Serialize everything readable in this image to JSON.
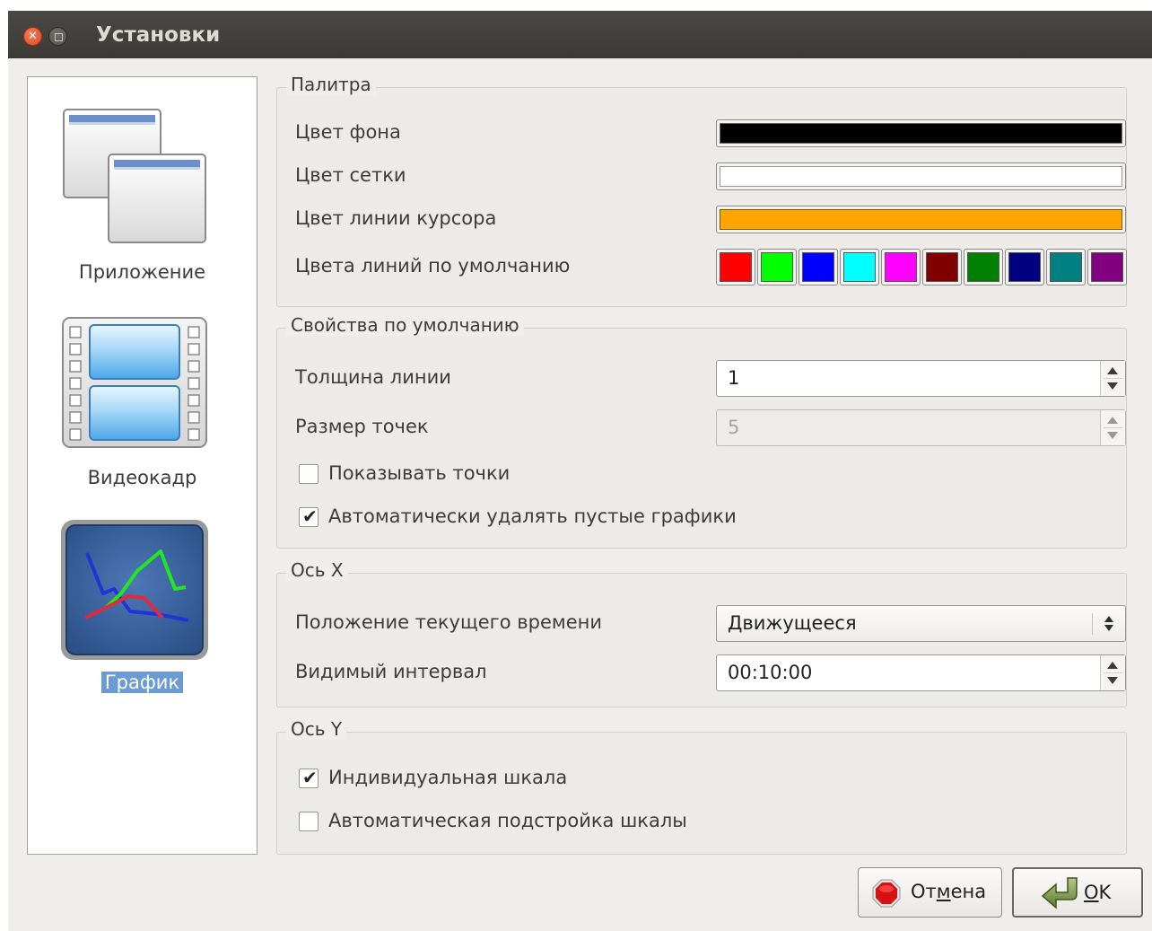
{
  "window": {
    "title": "Установки"
  },
  "sidebar": {
    "items": [
      {
        "label": "Приложение",
        "selected": false,
        "icon": "application-windows-icon"
      },
      {
        "label": "Видеокадр",
        "selected": false,
        "icon": "video-frame-icon"
      },
      {
        "label": "График",
        "selected": true,
        "icon": "chart-icon"
      }
    ]
  },
  "palette": {
    "title": "Палитра",
    "background_color": {
      "label": "Цвет фона",
      "value": "#000000"
    },
    "grid_color": {
      "label": "Цвет сетки",
      "value": "#ffffff"
    },
    "cursor_line_color": {
      "label": "Цвет линии курсора",
      "value": "#ffa500"
    },
    "default_line_colors": {
      "label": "Цвета линий по умолчанию",
      "values": [
        "#ff0000",
        "#00ff00",
        "#0000ff",
        "#00ffff",
        "#ff00ff",
        "#800000",
        "#008000",
        "#000080",
        "#008080",
        "#800080"
      ]
    }
  },
  "defaults": {
    "title": "Свойства по умолчанию",
    "line_width": {
      "label": "Толщина линии",
      "value": "1"
    },
    "point_size": {
      "label": "Размер точек",
      "value": "5"
    },
    "show_points": {
      "label": "Показывать точки",
      "checked": false
    },
    "auto_remove_empty": {
      "label": "Автоматически удалять пустые графики",
      "checked": true
    }
  },
  "axis_x": {
    "title": "Ось X",
    "current_time_position": {
      "label": "Положение текущего времени",
      "value": "Движущееся"
    },
    "visible_interval": {
      "label": "Видимый интервал",
      "value": "00:10:00"
    }
  },
  "axis_y": {
    "title": "Ось Y",
    "individual_scale": {
      "label": "Индивидуальная шкала",
      "checked": true
    },
    "auto_scale": {
      "label": "Автоматическая подстройка шкалы",
      "checked": false
    }
  },
  "buttons": {
    "cancel": {
      "pre": "От",
      "mnemonic": "м",
      "post": "ена",
      "icon": "stop-sign-icon"
    },
    "ok": {
      "pre": "",
      "mnemonic": "O",
      "post": "K",
      "icon": "return-arrow-icon"
    }
  },
  "check_glyph": "✔"
}
